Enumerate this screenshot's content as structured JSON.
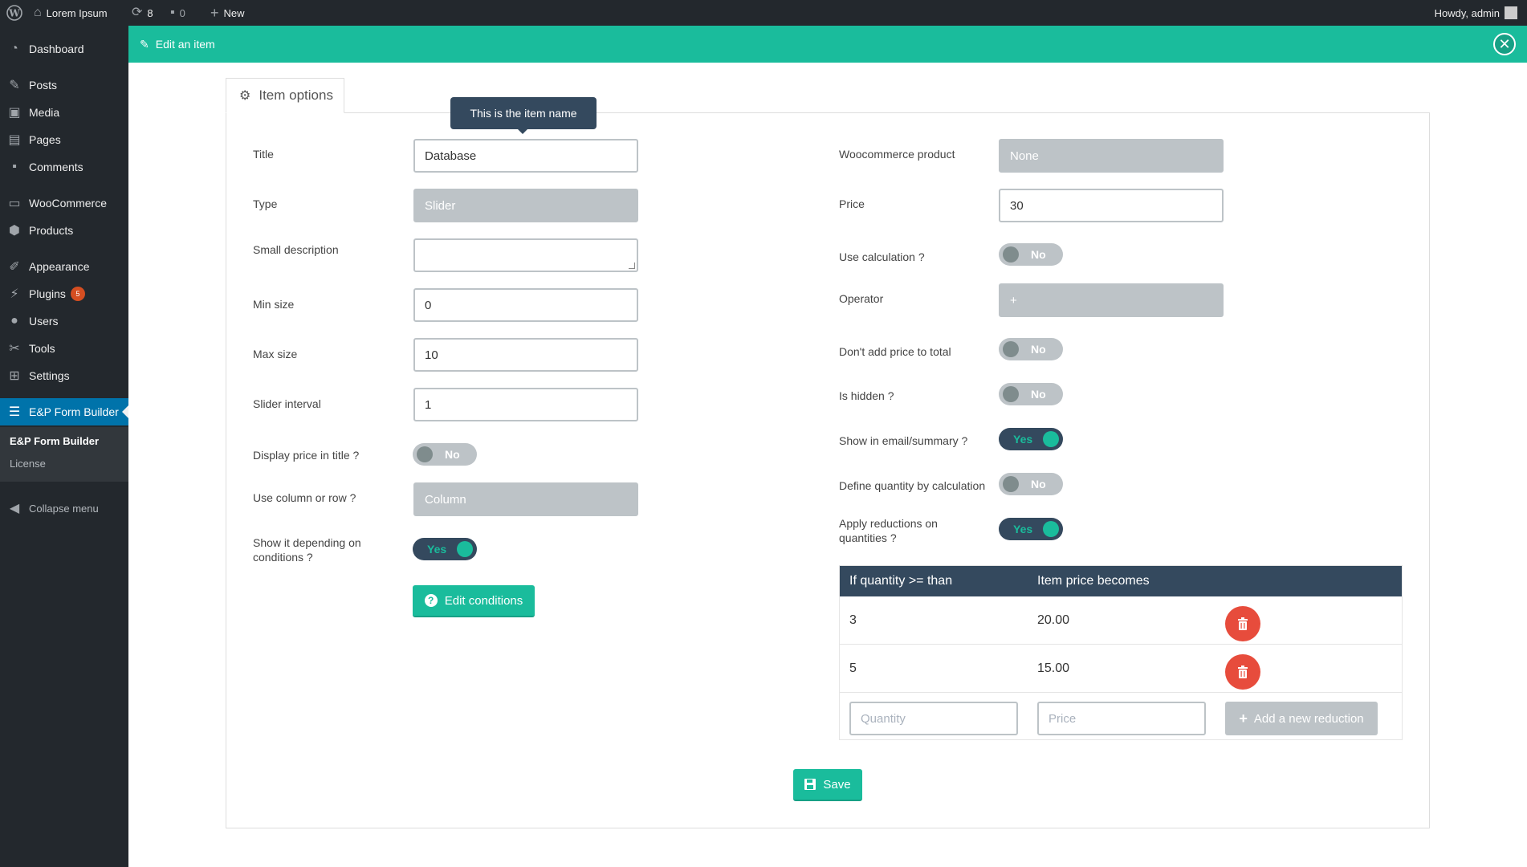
{
  "adminbar": {
    "site_name": "Lorem Ipsum",
    "updates_count": "8",
    "comments_count": "0",
    "new_label": "New",
    "howdy": "Howdy, admin"
  },
  "sidebar": {
    "items": [
      {
        "label": "Dashboard",
        "icon": "dashboard-icon"
      },
      {
        "label": "Posts",
        "icon": "pin-icon"
      },
      {
        "label": "Media",
        "icon": "media-icon"
      },
      {
        "label": "Pages",
        "icon": "pages-icon"
      },
      {
        "label": "Comments",
        "icon": "comment-icon"
      },
      {
        "label": "WooCommerce",
        "icon": "woocommerce-icon"
      },
      {
        "label": "Products",
        "icon": "products-icon"
      },
      {
        "label": "Appearance",
        "icon": "brush-icon"
      },
      {
        "label": "Plugins",
        "icon": "plugin-icon",
        "badge": "5"
      },
      {
        "label": "Users",
        "icon": "user-icon"
      },
      {
        "label": "Tools",
        "icon": "wrench-icon"
      },
      {
        "label": "Settings",
        "icon": "settings-icon"
      },
      {
        "label": "E&P Form Builder",
        "icon": "form-icon"
      }
    ],
    "submenu": [
      "E&P Form Builder",
      "License"
    ],
    "collapse_label": "Collapse menu"
  },
  "panel": {
    "title": "Edit an item",
    "close_icon": "close-icon"
  },
  "tab": {
    "label": "Item options"
  },
  "tooltip": "This is the item name",
  "left_form": {
    "title_label": "Title",
    "title_value": "Database",
    "type_label": "Type",
    "type_value": "Slider",
    "small_desc_label": "Small description",
    "small_desc_value": "",
    "min_size_label": "Min size",
    "min_size_value": "0",
    "max_size_label": "Max size",
    "max_size_value": "10",
    "slider_interval_label": "Slider interval",
    "slider_interval_value": "1",
    "display_price_label": "Display price in title ?",
    "display_price_value": "No",
    "column_row_label": "Use column or row ?",
    "column_row_value": "Column",
    "show_depending_label_1": "Show it depending on",
    "show_depending_label_2": "conditions ?",
    "show_depending_value": "Yes",
    "edit_conditions_label": "Edit conditions"
  },
  "right_form": {
    "woo_product_label": "Woocommerce product",
    "woo_product_value": "None",
    "price_label": "Price",
    "price_value": "30",
    "use_calc_label": "Use calculation ?",
    "use_calc_value": "No",
    "operator_label": "Operator",
    "operator_value": "+",
    "dont_add_label": "Don't add price to total",
    "dont_add_value": "No",
    "is_hidden_label": "Is hidden ?",
    "is_hidden_value": "No",
    "show_email_label": "Show in email/summary ?",
    "show_email_value": "Yes",
    "define_qty_label": "Define quantity by calculation",
    "define_qty_value": "No",
    "apply_red_label_1": "Apply reductions on",
    "apply_red_label_2": "quantities ?",
    "apply_red_value": "Yes"
  },
  "reductions": {
    "headers": [
      "If quantity >= than",
      "Item price becomes"
    ],
    "rows": [
      {
        "quantity": "3",
        "price": "20.00"
      },
      {
        "quantity": "5",
        "price": "15.00"
      }
    ],
    "quantity_placeholder": "Quantity",
    "price_placeholder": "Price",
    "add_label": "Add a new reduction"
  },
  "save_label": "Save",
  "colors": {
    "accent": "#1abc9c",
    "dark": "#34495e",
    "danger": "#e74c3c",
    "wp_dark": "#23282d",
    "wp_active": "#0073aa"
  }
}
